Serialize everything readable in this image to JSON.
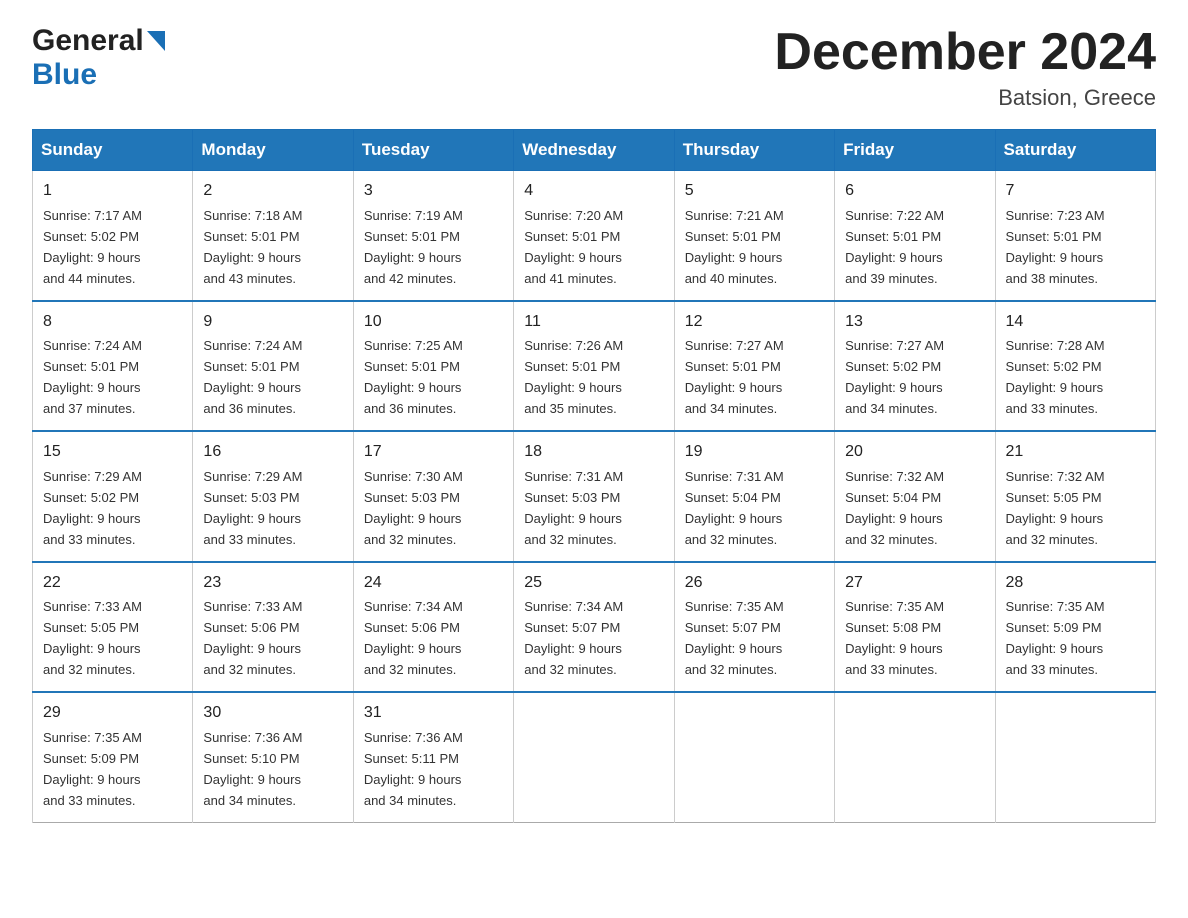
{
  "header": {
    "logo_general": "General",
    "logo_blue": "Blue",
    "month_title": "December 2024",
    "location": "Batsion, Greece"
  },
  "days_of_week": [
    "Sunday",
    "Monday",
    "Tuesday",
    "Wednesday",
    "Thursday",
    "Friday",
    "Saturday"
  ],
  "weeks": [
    [
      {
        "date": "1",
        "sunrise": "7:17 AM",
        "sunset": "5:02 PM",
        "daylight": "9 hours and 44 minutes."
      },
      {
        "date": "2",
        "sunrise": "7:18 AM",
        "sunset": "5:01 PM",
        "daylight": "9 hours and 43 minutes."
      },
      {
        "date": "3",
        "sunrise": "7:19 AM",
        "sunset": "5:01 PM",
        "daylight": "9 hours and 42 minutes."
      },
      {
        "date": "4",
        "sunrise": "7:20 AM",
        "sunset": "5:01 PM",
        "daylight": "9 hours and 41 minutes."
      },
      {
        "date": "5",
        "sunrise": "7:21 AM",
        "sunset": "5:01 PM",
        "daylight": "9 hours and 40 minutes."
      },
      {
        "date": "6",
        "sunrise": "7:22 AM",
        "sunset": "5:01 PM",
        "daylight": "9 hours and 39 minutes."
      },
      {
        "date": "7",
        "sunrise": "7:23 AM",
        "sunset": "5:01 PM",
        "daylight": "9 hours and 38 minutes."
      }
    ],
    [
      {
        "date": "8",
        "sunrise": "7:24 AM",
        "sunset": "5:01 PM",
        "daylight": "9 hours and 37 minutes."
      },
      {
        "date": "9",
        "sunrise": "7:24 AM",
        "sunset": "5:01 PM",
        "daylight": "9 hours and 36 minutes."
      },
      {
        "date": "10",
        "sunrise": "7:25 AM",
        "sunset": "5:01 PM",
        "daylight": "9 hours and 36 minutes."
      },
      {
        "date": "11",
        "sunrise": "7:26 AM",
        "sunset": "5:01 PM",
        "daylight": "9 hours and 35 minutes."
      },
      {
        "date": "12",
        "sunrise": "7:27 AM",
        "sunset": "5:01 PM",
        "daylight": "9 hours and 34 minutes."
      },
      {
        "date": "13",
        "sunrise": "7:27 AM",
        "sunset": "5:02 PM",
        "daylight": "9 hours and 34 minutes."
      },
      {
        "date": "14",
        "sunrise": "7:28 AM",
        "sunset": "5:02 PM",
        "daylight": "9 hours and 33 minutes."
      }
    ],
    [
      {
        "date": "15",
        "sunrise": "7:29 AM",
        "sunset": "5:02 PM",
        "daylight": "9 hours and 33 minutes."
      },
      {
        "date": "16",
        "sunrise": "7:29 AM",
        "sunset": "5:03 PM",
        "daylight": "9 hours and 33 minutes."
      },
      {
        "date": "17",
        "sunrise": "7:30 AM",
        "sunset": "5:03 PM",
        "daylight": "9 hours and 32 minutes."
      },
      {
        "date": "18",
        "sunrise": "7:31 AM",
        "sunset": "5:03 PM",
        "daylight": "9 hours and 32 minutes."
      },
      {
        "date": "19",
        "sunrise": "7:31 AM",
        "sunset": "5:04 PM",
        "daylight": "9 hours and 32 minutes."
      },
      {
        "date": "20",
        "sunrise": "7:32 AM",
        "sunset": "5:04 PM",
        "daylight": "9 hours and 32 minutes."
      },
      {
        "date": "21",
        "sunrise": "7:32 AM",
        "sunset": "5:05 PM",
        "daylight": "9 hours and 32 minutes."
      }
    ],
    [
      {
        "date": "22",
        "sunrise": "7:33 AM",
        "sunset": "5:05 PM",
        "daylight": "9 hours and 32 minutes."
      },
      {
        "date": "23",
        "sunrise": "7:33 AM",
        "sunset": "5:06 PM",
        "daylight": "9 hours and 32 minutes."
      },
      {
        "date": "24",
        "sunrise": "7:34 AM",
        "sunset": "5:06 PM",
        "daylight": "9 hours and 32 minutes."
      },
      {
        "date": "25",
        "sunrise": "7:34 AM",
        "sunset": "5:07 PM",
        "daylight": "9 hours and 32 minutes."
      },
      {
        "date": "26",
        "sunrise": "7:35 AM",
        "sunset": "5:07 PM",
        "daylight": "9 hours and 32 minutes."
      },
      {
        "date": "27",
        "sunrise": "7:35 AM",
        "sunset": "5:08 PM",
        "daylight": "9 hours and 33 minutes."
      },
      {
        "date": "28",
        "sunrise": "7:35 AM",
        "sunset": "5:09 PM",
        "daylight": "9 hours and 33 minutes."
      }
    ],
    [
      {
        "date": "29",
        "sunrise": "7:35 AM",
        "sunset": "5:09 PM",
        "daylight": "9 hours and 33 minutes."
      },
      {
        "date": "30",
        "sunrise": "7:36 AM",
        "sunset": "5:10 PM",
        "daylight": "9 hours and 34 minutes."
      },
      {
        "date": "31",
        "sunrise": "7:36 AM",
        "sunset": "5:11 PM",
        "daylight": "9 hours and 34 minutes."
      },
      null,
      null,
      null,
      null
    ]
  ],
  "labels": {
    "sunrise": "Sunrise:",
    "sunset": "Sunset:",
    "daylight": "Daylight:"
  }
}
